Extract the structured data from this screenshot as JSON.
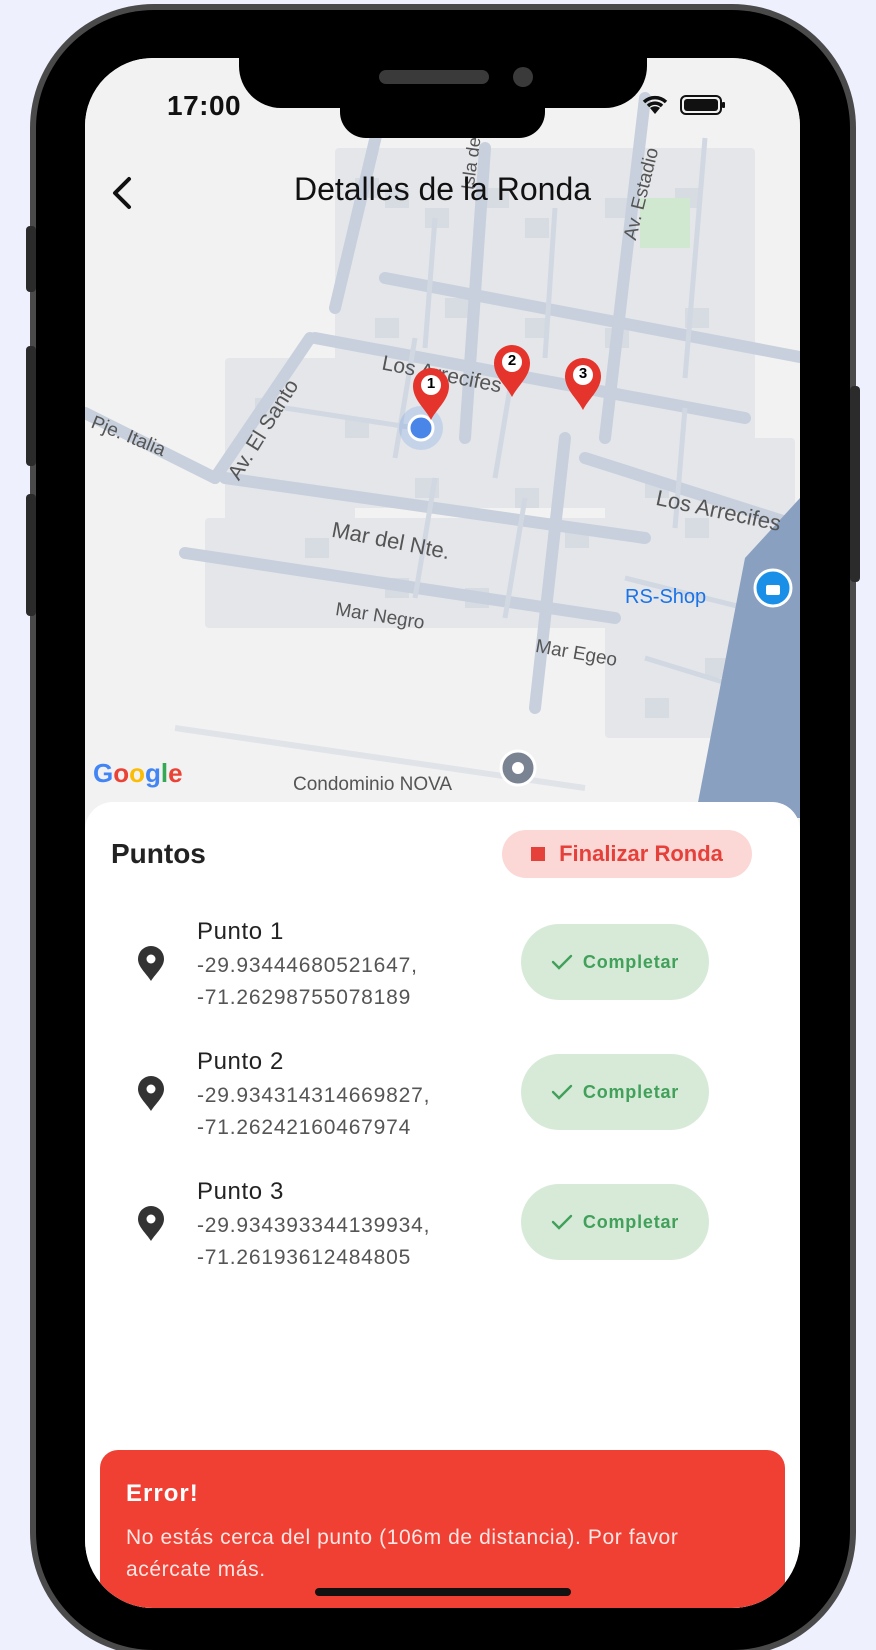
{
  "status_bar": {
    "time": "17:00"
  },
  "header": {
    "title": "Detalles de la Ronda"
  },
  "map": {
    "attribution": "Google",
    "labels": {
      "los_arrecifes_top": "Los Arrecifes",
      "los_arrecifes_right": "Los Arrecifes",
      "av_el_santo": "Av. El Santo",
      "pje_italia": "Pje. Italia",
      "mar_del_nte": "Mar del Nte.",
      "mar_negro": "Mar Negro",
      "mar_egeo": "Mar Egeo",
      "av_estadio": "Av. Estadio",
      "isla_de": "Isla de",
      "rs_shop": "RS-Shop",
      "condominio": "Condominio NOVA"
    },
    "markers": [
      "1",
      "2",
      "3"
    ]
  },
  "sheet": {
    "title": "Puntos",
    "finish_label": "Finalizar Ronda",
    "points": [
      {
        "name": "Punto 1",
        "lat": "-29.93444680521647,",
        "lng": "-71.26298755078189",
        "action": "Completar"
      },
      {
        "name": "Punto 2",
        "lat": "-29.934314314669827,",
        "lng": "-71.26242160467974",
        "action": "Completar"
      },
      {
        "name": "Punto 3",
        "lat": "-29.934393344139934,",
        "lng": "-71.26193612484805",
        "action": "Completar"
      }
    ]
  },
  "error": {
    "title": "Error!",
    "message": "No estás cerca del punto (106m de distancia). Por favor acércate más."
  },
  "colors": {
    "accent_red": "#f04034",
    "success_green": "#41a05a",
    "pin_red": "#e5342b",
    "location_blue": "#4a86e8"
  }
}
